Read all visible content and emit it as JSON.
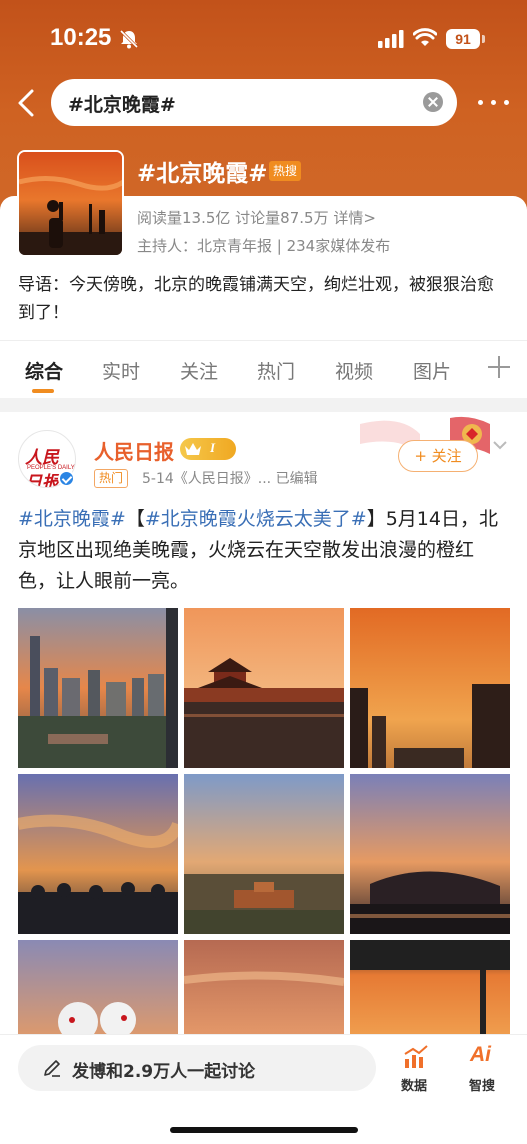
{
  "status_bar": {
    "time": "10:25",
    "battery": "91"
  },
  "search": {
    "query": "#北京晚霞#"
  },
  "topic": {
    "title": "#北京晚霞#",
    "hot_badge": "热搜",
    "stats": "阅读量13.5亿  讨论量87.5万  详情>",
    "host": "主持人：北京青年报 | 234家媒体发布",
    "guide": "导语：今天傍晚，北京的晚霞铺满天空，绚烂壮观，被狠狠治愈到了！"
  },
  "tabs": [
    "综合",
    "实时",
    "关注",
    "热门",
    "视频",
    "图片"
  ],
  "post": {
    "avatar_logo": "人民日报",
    "avatar_sub": "PEOPLE'S DAILY",
    "author": "人民日报",
    "hot_tag": "热门",
    "meta": "5-14《人民日报》... 已编辑",
    "follow_label": "+ 关注",
    "text_topic_1": "#北京晚霞#",
    "text_bracket_open": "【",
    "text_topic_2": "#北京晚霞火烧云太美了#",
    "text_body": "】5月14日，北京地区出现绝美晚霞，火烧云在天空散发出浪漫的橙红色，让人眼前一亮。"
  },
  "bottom_bar": {
    "compose": "发博和2.9万人一起讨论",
    "data_label": "数据",
    "ai_label": "智搜",
    "ai_icon_text": "Ai"
  },
  "colors": {
    "accent": "#f08c20",
    "link": "#3a6fb6",
    "author": "#e8602c",
    "header": "#c2521a"
  }
}
